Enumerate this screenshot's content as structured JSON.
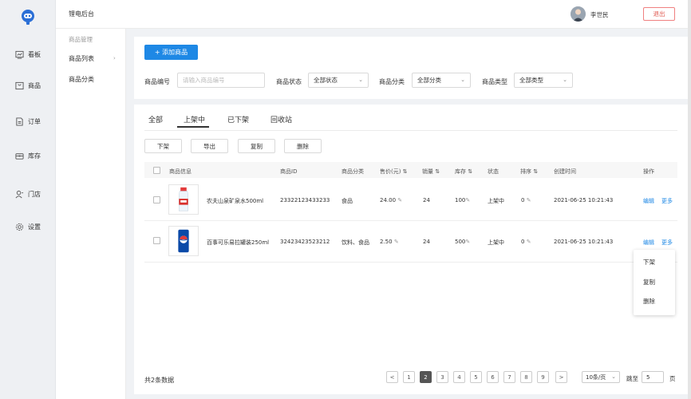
{
  "app": {
    "title": "锂电后台"
  },
  "rail": [
    {
      "label": "看板",
      "icon": "dashboard-icon"
    },
    {
      "label": "商品",
      "icon": "product-icon"
    },
    {
      "label": "订单",
      "icon": "order-icon"
    },
    {
      "label": "库存",
      "icon": "inventory-icon"
    },
    {
      "label": "门店",
      "icon": "store-icon"
    },
    {
      "label": "设置",
      "icon": "settings-icon"
    }
  ],
  "user": {
    "name": "李世民",
    "logout": "退出"
  },
  "submenu": {
    "group": "商品管理",
    "items": [
      "商品列表",
      "商品分类"
    ]
  },
  "toolbar": {
    "add": "+ 添加商品"
  },
  "filters": {
    "code_label": "商品编号",
    "code_placeholder": "请输入商品编号",
    "status_label": "商品状态",
    "status_value": "全部状态",
    "category_label": "商品分类",
    "category_value": "全部分类",
    "type_label": "商品类型",
    "type_value": "全部类型"
  },
  "tabs": [
    "全部",
    "上架中",
    "已下架",
    "回收站"
  ],
  "actions": [
    "下架",
    "导出",
    "复制",
    "删除"
  ],
  "columns": [
    "商品信息",
    "商品ID",
    "商品分类",
    "售价(元) ⇅",
    "销量 ⇅",
    "库存 ⇅",
    "状态",
    "排序 ⇅",
    "创建时间",
    "操作"
  ],
  "rows": [
    {
      "name": "农夫山泉矿泉水500ml",
      "id": "23322123433233",
      "category": "食品",
      "price": "24.00",
      "sales": "24",
      "stock": "100",
      "status": "上架中",
      "sort": "0",
      "created": "2021-06-25 10:21:43",
      "edit": "编辑",
      "more": "更多"
    },
    {
      "name": "百事可乐易拉罐装250ml",
      "id": "32423423523212",
      "category": "饮料、食品",
      "price": "2.50",
      "sales": "24",
      "stock": "500",
      "status": "上架中",
      "sort": "0",
      "created": "2021-06-25 10:21:43",
      "edit": "编辑",
      "more": "更多"
    }
  ],
  "dropdown": [
    "下架",
    "复制",
    "删除"
  ],
  "pagination": {
    "total": "共2条数据",
    "pages": [
      "1",
      "2",
      "3",
      "4",
      "5",
      "6",
      "7",
      "8",
      "9"
    ],
    "current": "2",
    "prev": "<",
    "next": ">",
    "page_size": "10条/页",
    "goto_label": "跳至",
    "goto_value": "5",
    "page_suffix": "页"
  }
}
